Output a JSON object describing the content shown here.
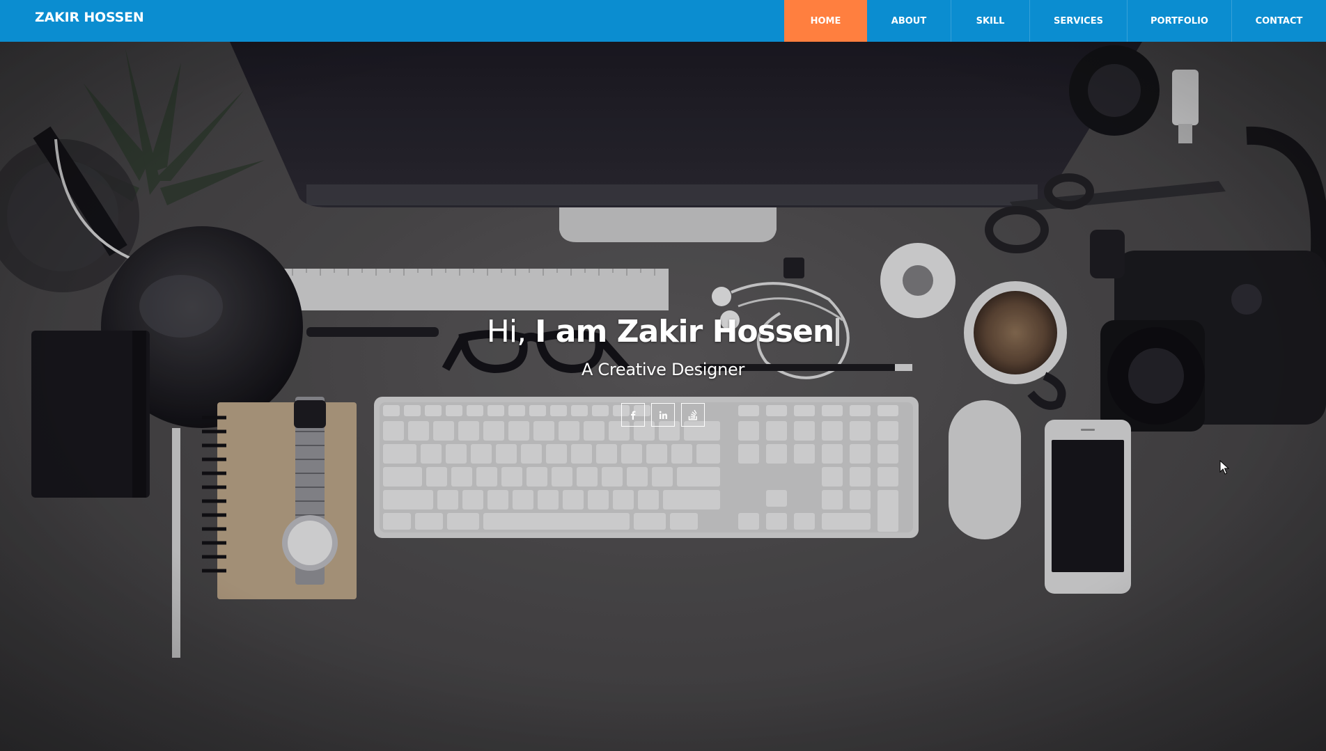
{
  "header": {
    "brand": "ZAKIR HOSSEN"
  },
  "nav": {
    "items": [
      {
        "label": "HOME",
        "active": true
      },
      {
        "label": "ABOUT",
        "active": false
      },
      {
        "label": "SKILL",
        "active": false
      },
      {
        "label": "SERVICES",
        "active": false
      },
      {
        "label": "PORTFOLIO",
        "active": false
      },
      {
        "label": "CONTACT",
        "active": false
      }
    ]
  },
  "hero": {
    "greeting": "Hi,",
    "name": "I am Zakir Hossen",
    "subtitle": "A Creative Designer",
    "socials": [
      {
        "icon": "facebook-icon"
      },
      {
        "icon": "linkedin-icon"
      },
      {
        "icon": "stack-overflow-icon"
      }
    ]
  },
  "colors": {
    "navbar": "#0b8dd0",
    "active_nav": "#ff7f3f",
    "text": "#ffffff"
  }
}
